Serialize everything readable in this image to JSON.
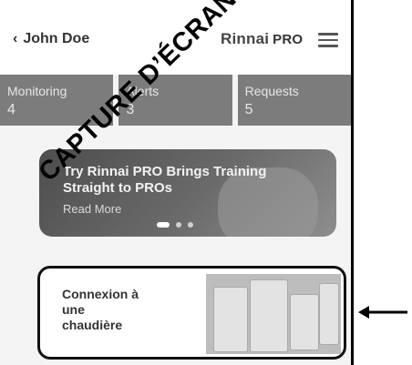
{
  "header": {
    "back_label": "John Doe",
    "brand": "Rinnai",
    "brand_suffix": "PRO"
  },
  "stats": [
    {
      "label": "Monitoring",
      "count": "4"
    },
    {
      "label": "Alerts",
      "count": "3"
    },
    {
      "label": "Requests",
      "count": "5"
    }
  ],
  "banner": {
    "title": "Try Rinnai PRO Brings Training Straight to PROs",
    "read_more": "Read More"
  },
  "card": {
    "line1": "Connexion à",
    "line2": "une",
    "line3": "chaudière"
  },
  "watermark": {
    "text": "CAPTURE D’ÉCRAN"
  },
  "colors": {
    "stat_bg": "#7c7c7c",
    "banner_bg": "#5a5a5a",
    "card_border": "#111111"
  },
  "icons": {
    "back": "chevron-left-icon",
    "menu": "hamburger-menu-icon",
    "pointer": "arrow-left-icon"
  }
}
